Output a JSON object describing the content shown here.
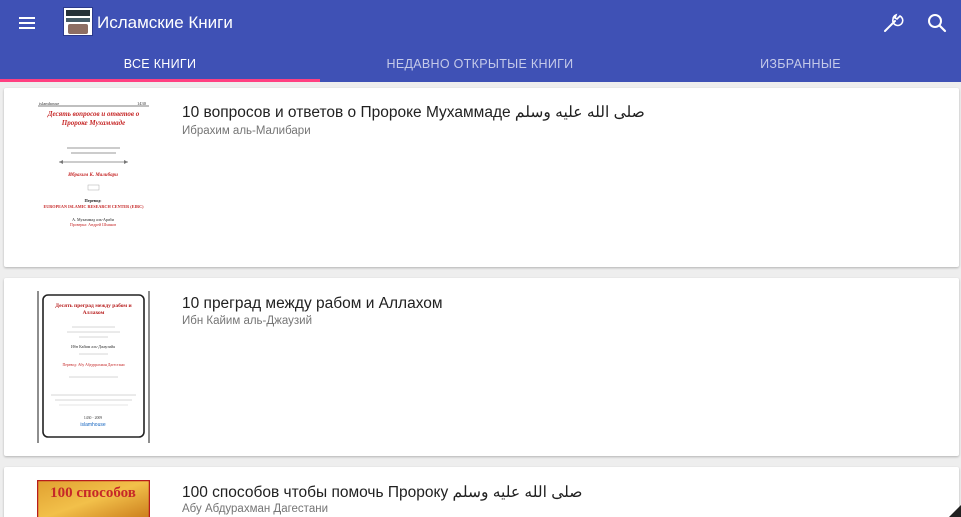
{
  "app": {
    "title": "Исламские Книги"
  },
  "toolbar": {
    "menu_icon": "menu-icon",
    "settings_icon": "wrench-icon",
    "search_icon": "search-icon"
  },
  "tabs": [
    {
      "label": "ВСЕ КНИГИ",
      "active": true
    },
    {
      "label": "НЕДАВНО ОТКРЫТЫЕ КНИГИ",
      "active": false
    },
    {
      "label": "ИЗБРАННЫЕ",
      "active": false
    }
  ],
  "books": [
    {
      "title": "10 вопросов и ответов о Пророке Мухаммаде صلى الله عليه وسلم",
      "author": "Ибрахим аль-Малибари",
      "cover": {
        "header_left": "islamhouse",
        "header_right": "1430",
        "title": "Десять вопросов и ответов о Пророке Мухаммаде",
        "author": "Ибрахим К. Малибари",
        "translation_label": "Перевод:",
        "org": "EUROPEAN ISLAMIC RESEARCH CENTER (EIRC)",
        "translator": "А. Мухаммад аль-Араби",
        "editor": "Проверка: Андрей Шмаков"
      }
    },
    {
      "title": "10 преград между рабом и Аллахом",
      "author": "Ибн Кайим аль-Джаузий",
      "cover": {
        "title": "Десять преград между рабом и Аллахом",
        "author": "Ибн Кайим аль-Джаузийя",
        "translator": "Перевод: Абу Абдуррахман Дагестани",
        "years": "1430 - 2009",
        "logo": "islamhouse"
      }
    },
    {
      "title": "100 способов чтобы помочь Пророку صلى الله عليه وسلم",
      "author": "Абу Абдурахман Дагестани",
      "cover": {
        "title": "100 способов"
      }
    }
  ],
  "colors": {
    "primary": "#3f51b5",
    "accent": "#ff4081",
    "background": "#eeeeee"
  }
}
